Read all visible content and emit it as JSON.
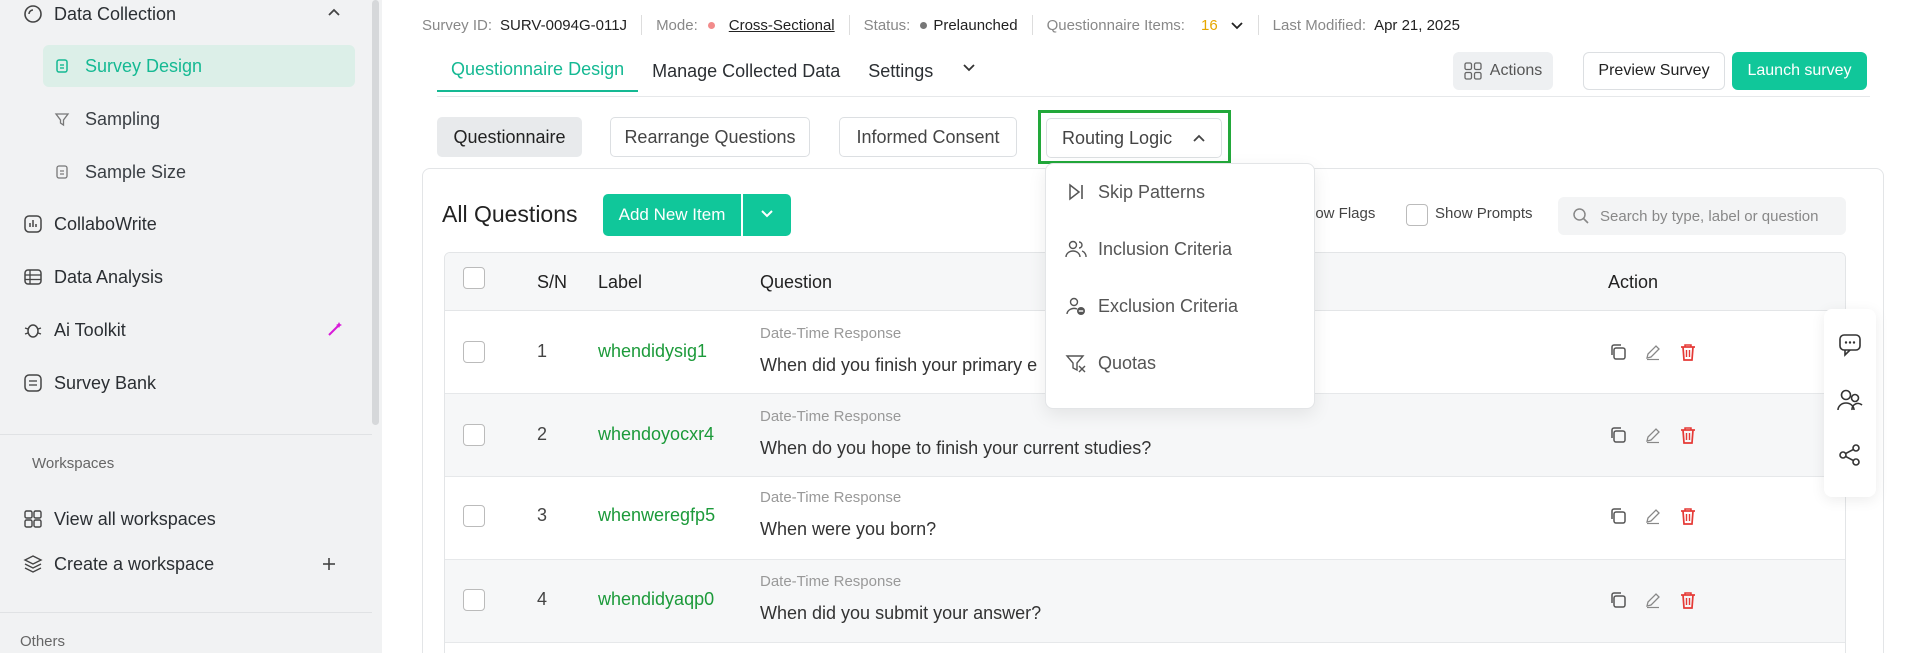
{
  "sidebar": {
    "data_collection": "Data Collection",
    "survey_design": "Survey Design",
    "sampling": "Sampling",
    "sample_size": "Sample Size",
    "collabowrite": "CollaboWrite",
    "data_analysis": "Data Analysis",
    "ai_toolkit": "Ai Toolkit",
    "survey_bank": "Survey Bank",
    "workspaces_heading": "Workspaces",
    "view_all_workspaces": "View all workspaces",
    "create_workspace": "Create a workspace",
    "others_heading": "Others"
  },
  "meta": {
    "survey_id_label": "Survey ID:",
    "survey_id": "SURV-0094G-011J",
    "mode_label": "Mode:",
    "mode": "Cross-Sectional",
    "status_label": "Status:",
    "status": "Prelaunched",
    "items_label": "Questionnaire Items:",
    "items_count": "16",
    "modified_label": "Last Modified:",
    "modified": "Apr 21, 2025"
  },
  "tabs": {
    "questionnaire_design": "Questionnaire Design",
    "manage_collected_data": "Manage Collected Data",
    "settings": "Settings"
  },
  "buttons": {
    "actions": "Actions",
    "preview": "Preview Survey",
    "launch": "Launch survey",
    "add_new_item": "Add New Item"
  },
  "subtabs": {
    "questionnaire": "Questionnaire",
    "rearrange": "Rearrange Questions",
    "informed_consent": "Informed Consent",
    "routing_logic": "Routing Logic"
  },
  "routing_menu": {
    "skip_patterns": "Skip Patterns",
    "inclusion": "Inclusion Criteria",
    "exclusion": "Exclusion Criteria",
    "quotas": "Quotas"
  },
  "questions": {
    "title": "All Questions",
    "flags_label": "how Flags",
    "prompts_label": "Show Prompts",
    "search_placeholder": "Search by type, label or question",
    "headers": {
      "sn": "S/N",
      "label": "Label",
      "question": "Question",
      "action": "Action"
    },
    "rows": [
      {
        "sn": "1",
        "label": "whendidysig1",
        "type": "Date-Time Response",
        "question": "When did you finish your primary e"
      },
      {
        "sn": "2",
        "label": "whendoyocxr4",
        "type": "Date-Time Response",
        "question": "When do you hope to finish your current studies?"
      },
      {
        "sn": "3",
        "label": "whenweregfp5",
        "type": "Date-Time Response",
        "question": "When were you born?"
      },
      {
        "sn": "4",
        "label": "whendidyaqp0",
        "type": "Date-Time Response",
        "question": "When did you submit your answer?"
      }
    ]
  },
  "colors": {
    "accent": "#10c79a",
    "label_green": "#1c9a3a",
    "danger": "#e53935",
    "items_count": "#e6a700",
    "mode_dot": "#f28b8b",
    "status_dot": "#777777",
    "highlight": "#22a83a"
  }
}
